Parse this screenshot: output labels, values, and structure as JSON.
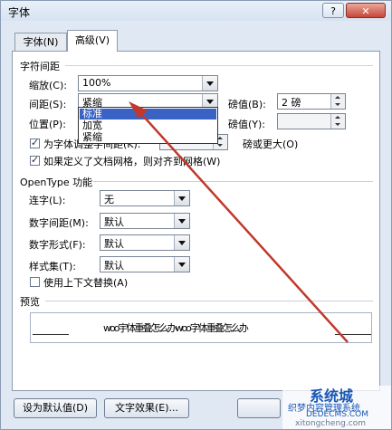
{
  "window": {
    "title": "字体",
    "help": "?",
    "close": "✕"
  },
  "tabs": [
    {
      "label": "字体(N)"
    },
    {
      "label": "高级(V)"
    }
  ],
  "char_spacing": {
    "section": "字符间距",
    "scale_label": "缩放(C):",
    "scale_value": "100%",
    "spacing_label": "间距(S):",
    "spacing_value": "紧缩",
    "spacing_amount_label": "磅值(B):",
    "spacing_amount_value": "2 磅",
    "position_label": "位置(P):",
    "position_value": "",
    "position_amount_label": "磅值(Y):",
    "position_amount_value": "",
    "kerning_label": "为字体调整字间距(K):",
    "kerning_suffix": "磅或更大(O)",
    "grid_label": "如果定义了文档网格，则对齐到网格(W)",
    "spacing_options": [
      "标准",
      "加宽",
      "紧缩"
    ]
  },
  "opentype": {
    "section": "OpenType 功能",
    "ligatures_label": "连字(L):",
    "ligatures_value": "无",
    "num_spacing_label": "数字间距(M):",
    "num_spacing_value": "默认",
    "num_form_label": "数字形式(F):",
    "num_form_value": "默认",
    "stylistic_label": "样式集(T):",
    "stylistic_value": "默认",
    "contextual_label": "使用上下文替换(A)"
  },
  "preview": {
    "section": "预览",
    "sample_text": "woo宇体重叠怎么办woo字体重叠怎么办"
  },
  "buttons": {
    "set_default": "设为默认值(D)",
    "text_effects": "文字效果(E)..."
  },
  "watermark": {
    "line1": "系统城",
    "line2": "织梦内容管理系统",
    "line3": "DEDECMS.COM",
    "line4": "xitongcheng.com"
  },
  "colors": {
    "accent": "#3a62c4",
    "arrow": "#c0392b"
  }
}
